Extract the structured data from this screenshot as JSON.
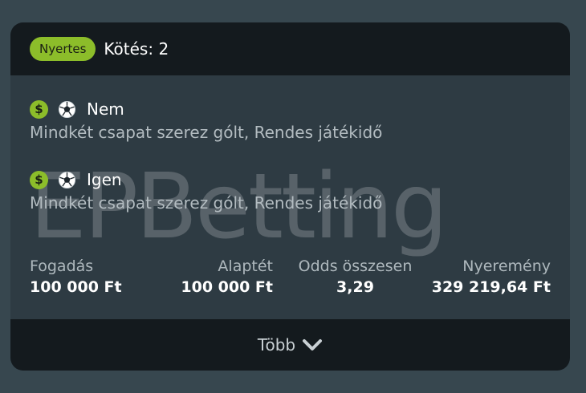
{
  "bet_card": {
    "status_badge": "Nyertes",
    "title": "Kötés: 2",
    "watermark": "EPBetting",
    "selections": [
      {
        "icons": [
          "dollar-coin-icon",
          "soccer-ball-icon"
        ],
        "pick": "Nem",
        "market": "Mindkét csapat szerez gólt, Rendes játékidő"
      },
      {
        "icons": [
          "dollar-coin-icon",
          "soccer-ball-icon"
        ],
        "pick": "Igen",
        "market": "Mindkét csapat szerez gólt, Rendes játékidő"
      }
    ],
    "stats": {
      "stake": {
        "label": "Fogadás",
        "value": "100 000 Ft"
      },
      "base_stake": {
        "label": "Alaptét",
        "value": "100 000 Ft"
      },
      "total_odds": {
        "label": "Odds összesen",
        "value": "3,29"
      },
      "winnings": {
        "label": "Nyeremény",
        "value": "329 219,64 Ft"
      }
    },
    "more_label": "Több"
  },
  "colors": {
    "page_background": "#37474f",
    "card_body": "#2e3b43",
    "card_header_footer": "#141a1e",
    "accent_green": "#8cbd2a",
    "muted_text": "#aeb8bd"
  }
}
